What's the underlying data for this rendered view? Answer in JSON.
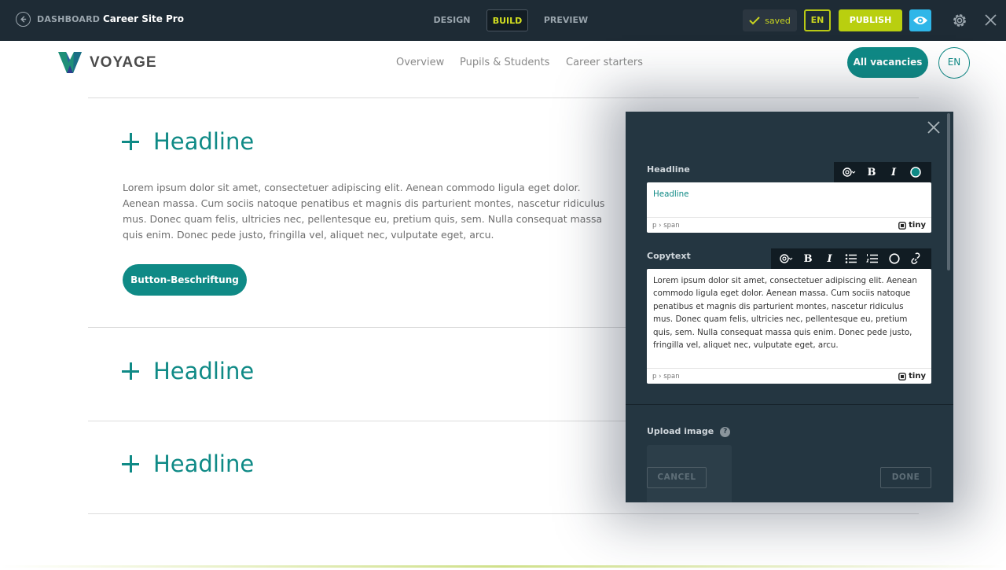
{
  "topbar": {
    "back_label": "DASHBOARD",
    "site_name": "Career Site Pro",
    "modes": {
      "design": "DESIGN",
      "build": "BUILD",
      "preview": "PREVIEW"
    },
    "saved_label": "saved",
    "lang_label": "EN",
    "publish_label": "PUBLISH"
  },
  "site": {
    "logo_text": "VOYAGE",
    "nav": [
      "Overview",
      "Pupils & Students",
      "Career starters"
    ],
    "vacancies_label": "All vacancies",
    "lang_label": "EN"
  },
  "accordion": {
    "items": [
      {
        "title": "Headline"
      },
      {
        "title": "Headline"
      },
      {
        "title": "Headline"
      }
    ],
    "copytext": "Lorem ipsum dolor sit amet, consectetuer adipiscing elit. Aenean commodo ligula eget dolor. Aenean massa. Cum sociis natoque penatibus et magnis dis parturient montes, nascetur ridiculus mus. Donec quam felis, ultricies nec, pellentesque eu, pretium quis, sem. Nulla consequat massa quis enim. Donec pede justo, fringilla vel, aliquet nec, vulputate eget, arcu.",
    "button_label": "Button-Beschriftung"
  },
  "panel": {
    "headline_label": "Headline",
    "headline_value": "Headline",
    "copytext_label": "Copytext",
    "copytext_value": "Lorem ipsum dolor sit amet, consectetuer adipiscing elit. Aenean commodo ligula eget dolor. Aenean massa. Cum sociis natoque penatibus et magnis dis parturient montes, nascetur ridiculus mus. Donec quam felis, ultricies nec, pellentesque eu, pretium quis, sem. Nulla consequat massa quis enim. Donec pede justo, fringilla vel, aliquet nec, vulputate eget, arcu.",
    "status_path": "p › span",
    "tiny_label": "tiny",
    "toolbar_bold": "B",
    "toolbar_italic": "I",
    "upload_label": "Upload image",
    "help_label": "?",
    "cancel_label": "CANCEL",
    "done_label": "DONE"
  },
  "colors": {
    "accent": "#0f8a86",
    "topbar_bg": "#1e2b35",
    "panel_bg": "#243641",
    "publish": "#b9cf0f",
    "preview_eye": "#2fb6e8"
  },
  "icons": {
    "back": "arrow-left-circle-icon",
    "saved": "check-icon",
    "preview": "eye-icon",
    "settings": "gear-icon",
    "close": "close-icon",
    "ai": "openai-icon",
    "bullets": "bullet-list-icon",
    "numbers": "numbered-list-icon",
    "color": "color-circle-icon",
    "link": "link-icon",
    "accordion": "plus-icon"
  }
}
